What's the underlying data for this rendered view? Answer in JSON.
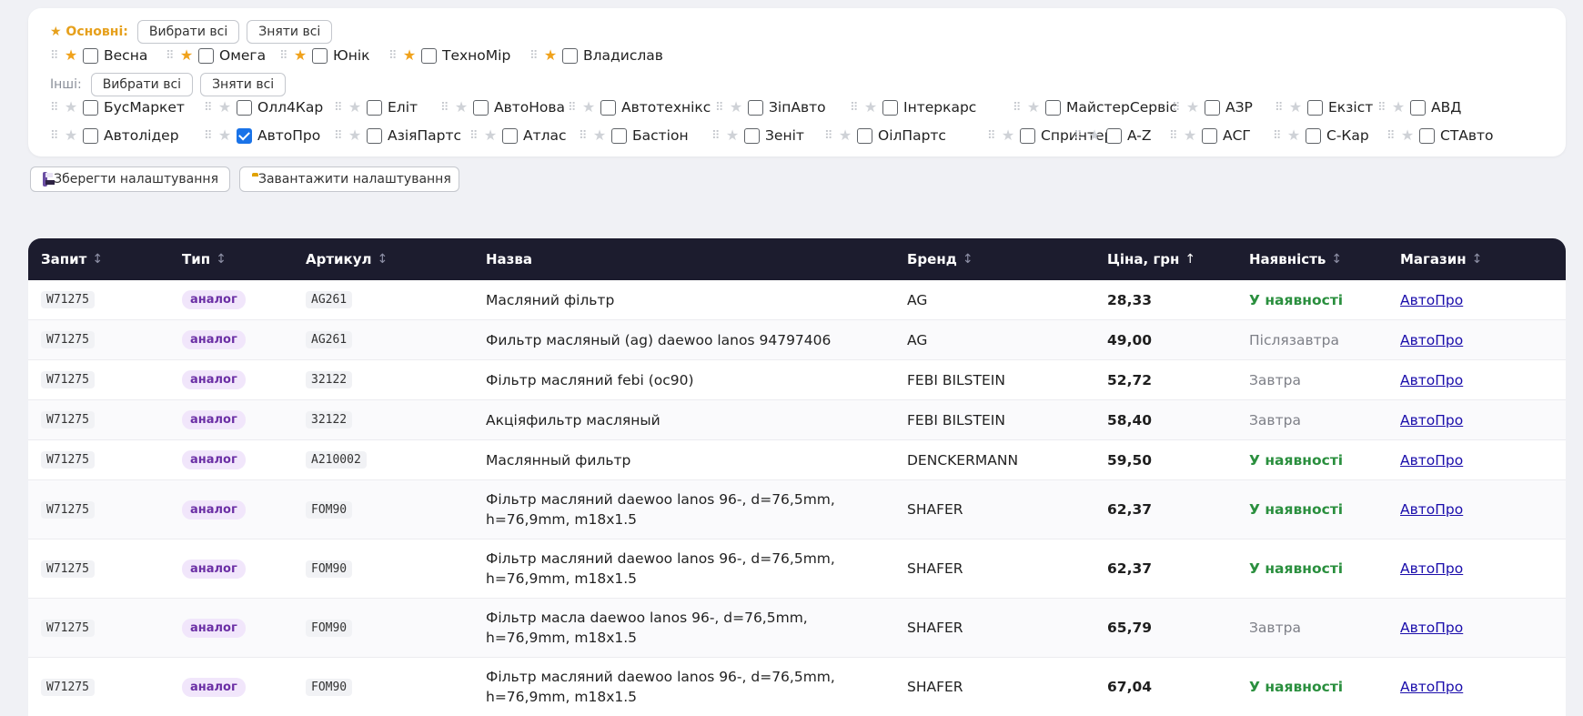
{
  "filters": {
    "main_label": "★ Основні:",
    "other_label": "Інші:",
    "select_all": "Вибрати всі",
    "deselect_all": "Зняти всі",
    "main_stores": [
      {
        "name": "Весна",
        "starred": true,
        "checked": false
      },
      {
        "name": "Омега",
        "starred": true,
        "checked": false
      },
      {
        "name": "Юнік",
        "starred": true,
        "checked": false
      },
      {
        "name": "ТехноМір",
        "starred": true,
        "checked": false
      },
      {
        "name": "Владислав",
        "starred": true,
        "checked": false
      }
    ],
    "other_stores_row1": [
      {
        "name": "БусМаркет",
        "checked": false
      },
      {
        "name": "Олл4Кар",
        "checked": false
      },
      {
        "name": "Еліт",
        "checked": false
      },
      {
        "name": "АвтоНова",
        "checked": false
      },
      {
        "name": "Автотехнікс",
        "checked": false
      },
      {
        "name": "ЗіпАвто",
        "checked": false
      },
      {
        "name": "Інтеркарс",
        "checked": false
      },
      {
        "name": "МайстерСервіс",
        "checked": false
      },
      {
        "name": "АЗР",
        "checked": false
      },
      {
        "name": "Екзіст",
        "checked": false
      },
      {
        "name": "АВД",
        "checked": false
      }
    ],
    "other_stores_row2": [
      {
        "name": "Автолідер",
        "checked": false
      },
      {
        "name": "АвтоПро",
        "checked": true
      },
      {
        "name": "АзіяПартс",
        "checked": false
      },
      {
        "name": "Атлас",
        "checked": false
      },
      {
        "name": "Бастіон",
        "checked": false
      },
      {
        "name": "Зеніт",
        "checked": false
      },
      {
        "name": "ОілПартс",
        "checked": false
      },
      {
        "name": "Спринтер",
        "checked": false
      },
      {
        "name": "A-Z",
        "checked": false
      },
      {
        "name": "АСГ",
        "checked": false
      },
      {
        "name": "С-Кар",
        "checked": false
      },
      {
        "name": "СТАвто",
        "checked": false
      }
    ]
  },
  "settings": {
    "save_label": "Зберегти налаштування",
    "load_label": "Завантажити налаштування"
  },
  "table": {
    "columns": [
      {
        "label": "Запит",
        "sort": "↕"
      },
      {
        "label": "Тип",
        "sort": "↕"
      },
      {
        "label": "Артикул",
        "sort": "↕"
      },
      {
        "label": "Назва",
        "sort": ""
      },
      {
        "label": "Бренд",
        "sort": "↕"
      },
      {
        "label": "Ціна, грн",
        "sort": "↑"
      },
      {
        "label": "Наявність",
        "sort": "↕"
      },
      {
        "label": "Магазин",
        "sort": "↕"
      }
    ],
    "rows": [
      {
        "query": "W71275",
        "type": "аналог",
        "sku": "AG261",
        "name": "Масляний фільтр",
        "brand": "AG",
        "price": "28,33",
        "availability": "У наявності",
        "in_stock": true,
        "shop": "АвтоПро"
      },
      {
        "query": "W71275",
        "type": "аналог",
        "sku": "AG261",
        "name": "Фильтр масляный (ag) daewoo lanos 94797406",
        "brand": "AG",
        "price": "49,00",
        "availability": "Післязавтра",
        "in_stock": false,
        "shop": "АвтоПро"
      },
      {
        "query": "W71275",
        "type": "аналог",
        "sku": "32122",
        "name": "Фільтр масляний febi (oc90)",
        "brand": "FEBI BILSTEIN",
        "price": "52,72",
        "availability": "Завтра",
        "in_stock": false,
        "shop": "АвтоПро"
      },
      {
        "query": "W71275",
        "type": "аналог",
        "sku": "32122",
        "name": "Акціяфильтр масляный",
        "brand": "FEBI BILSTEIN",
        "price": "58,40",
        "availability": "Завтра",
        "in_stock": false,
        "shop": "АвтоПро"
      },
      {
        "query": "W71275",
        "type": "аналог",
        "sku": "A210002",
        "name": "Маслянный фильтр",
        "brand": "DENCKERMANN",
        "price": "59,50",
        "availability": "У наявності",
        "in_stock": true,
        "shop": "АвтоПро"
      },
      {
        "query": "W71275",
        "type": "аналог",
        "sku": "FOM90",
        "name": "Фільтр масляний daewoo lanos 96-, d=76,5mm, h=76,9mm, m18x1.5",
        "brand": "SHAFER",
        "price": "62,37",
        "availability": "У наявності",
        "in_stock": true,
        "shop": "АвтоПро"
      },
      {
        "query": "W71275",
        "type": "аналог",
        "sku": "FOM90",
        "name": "Фільтр масляний daewoo lanos 96-, d=76,5mm, h=76,9mm, m18x1.5",
        "brand": "SHAFER",
        "price": "62,37",
        "availability": "У наявності",
        "in_stock": true,
        "shop": "АвтоПро"
      },
      {
        "query": "W71275",
        "type": "аналог",
        "sku": "FOM90",
        "name": "Фільтр масла daewoo lanos 96-, d=76,5mm, h=76,9mm, m18x1.5",
        "brand": "SHAFER",
        "price": "65,79",
        "availability": "Завтра",
        "in_stock": false,
        "shop": "АвтоПро"
      },
      {
        "query": "W71275",
        "type": "аналог",
        "sku": "FOM90",
        "name": "Фільтр масляний daewoo lanos 96-, d=76,5mm, h=76,9mm, m18x1.5",
        "brand": "SHAFER",
        "price": "67,04",
        "availability": "У наявності",
        "in_stock": true,
        "shop": "АвтоПро"
      }
    ]
  }
}
